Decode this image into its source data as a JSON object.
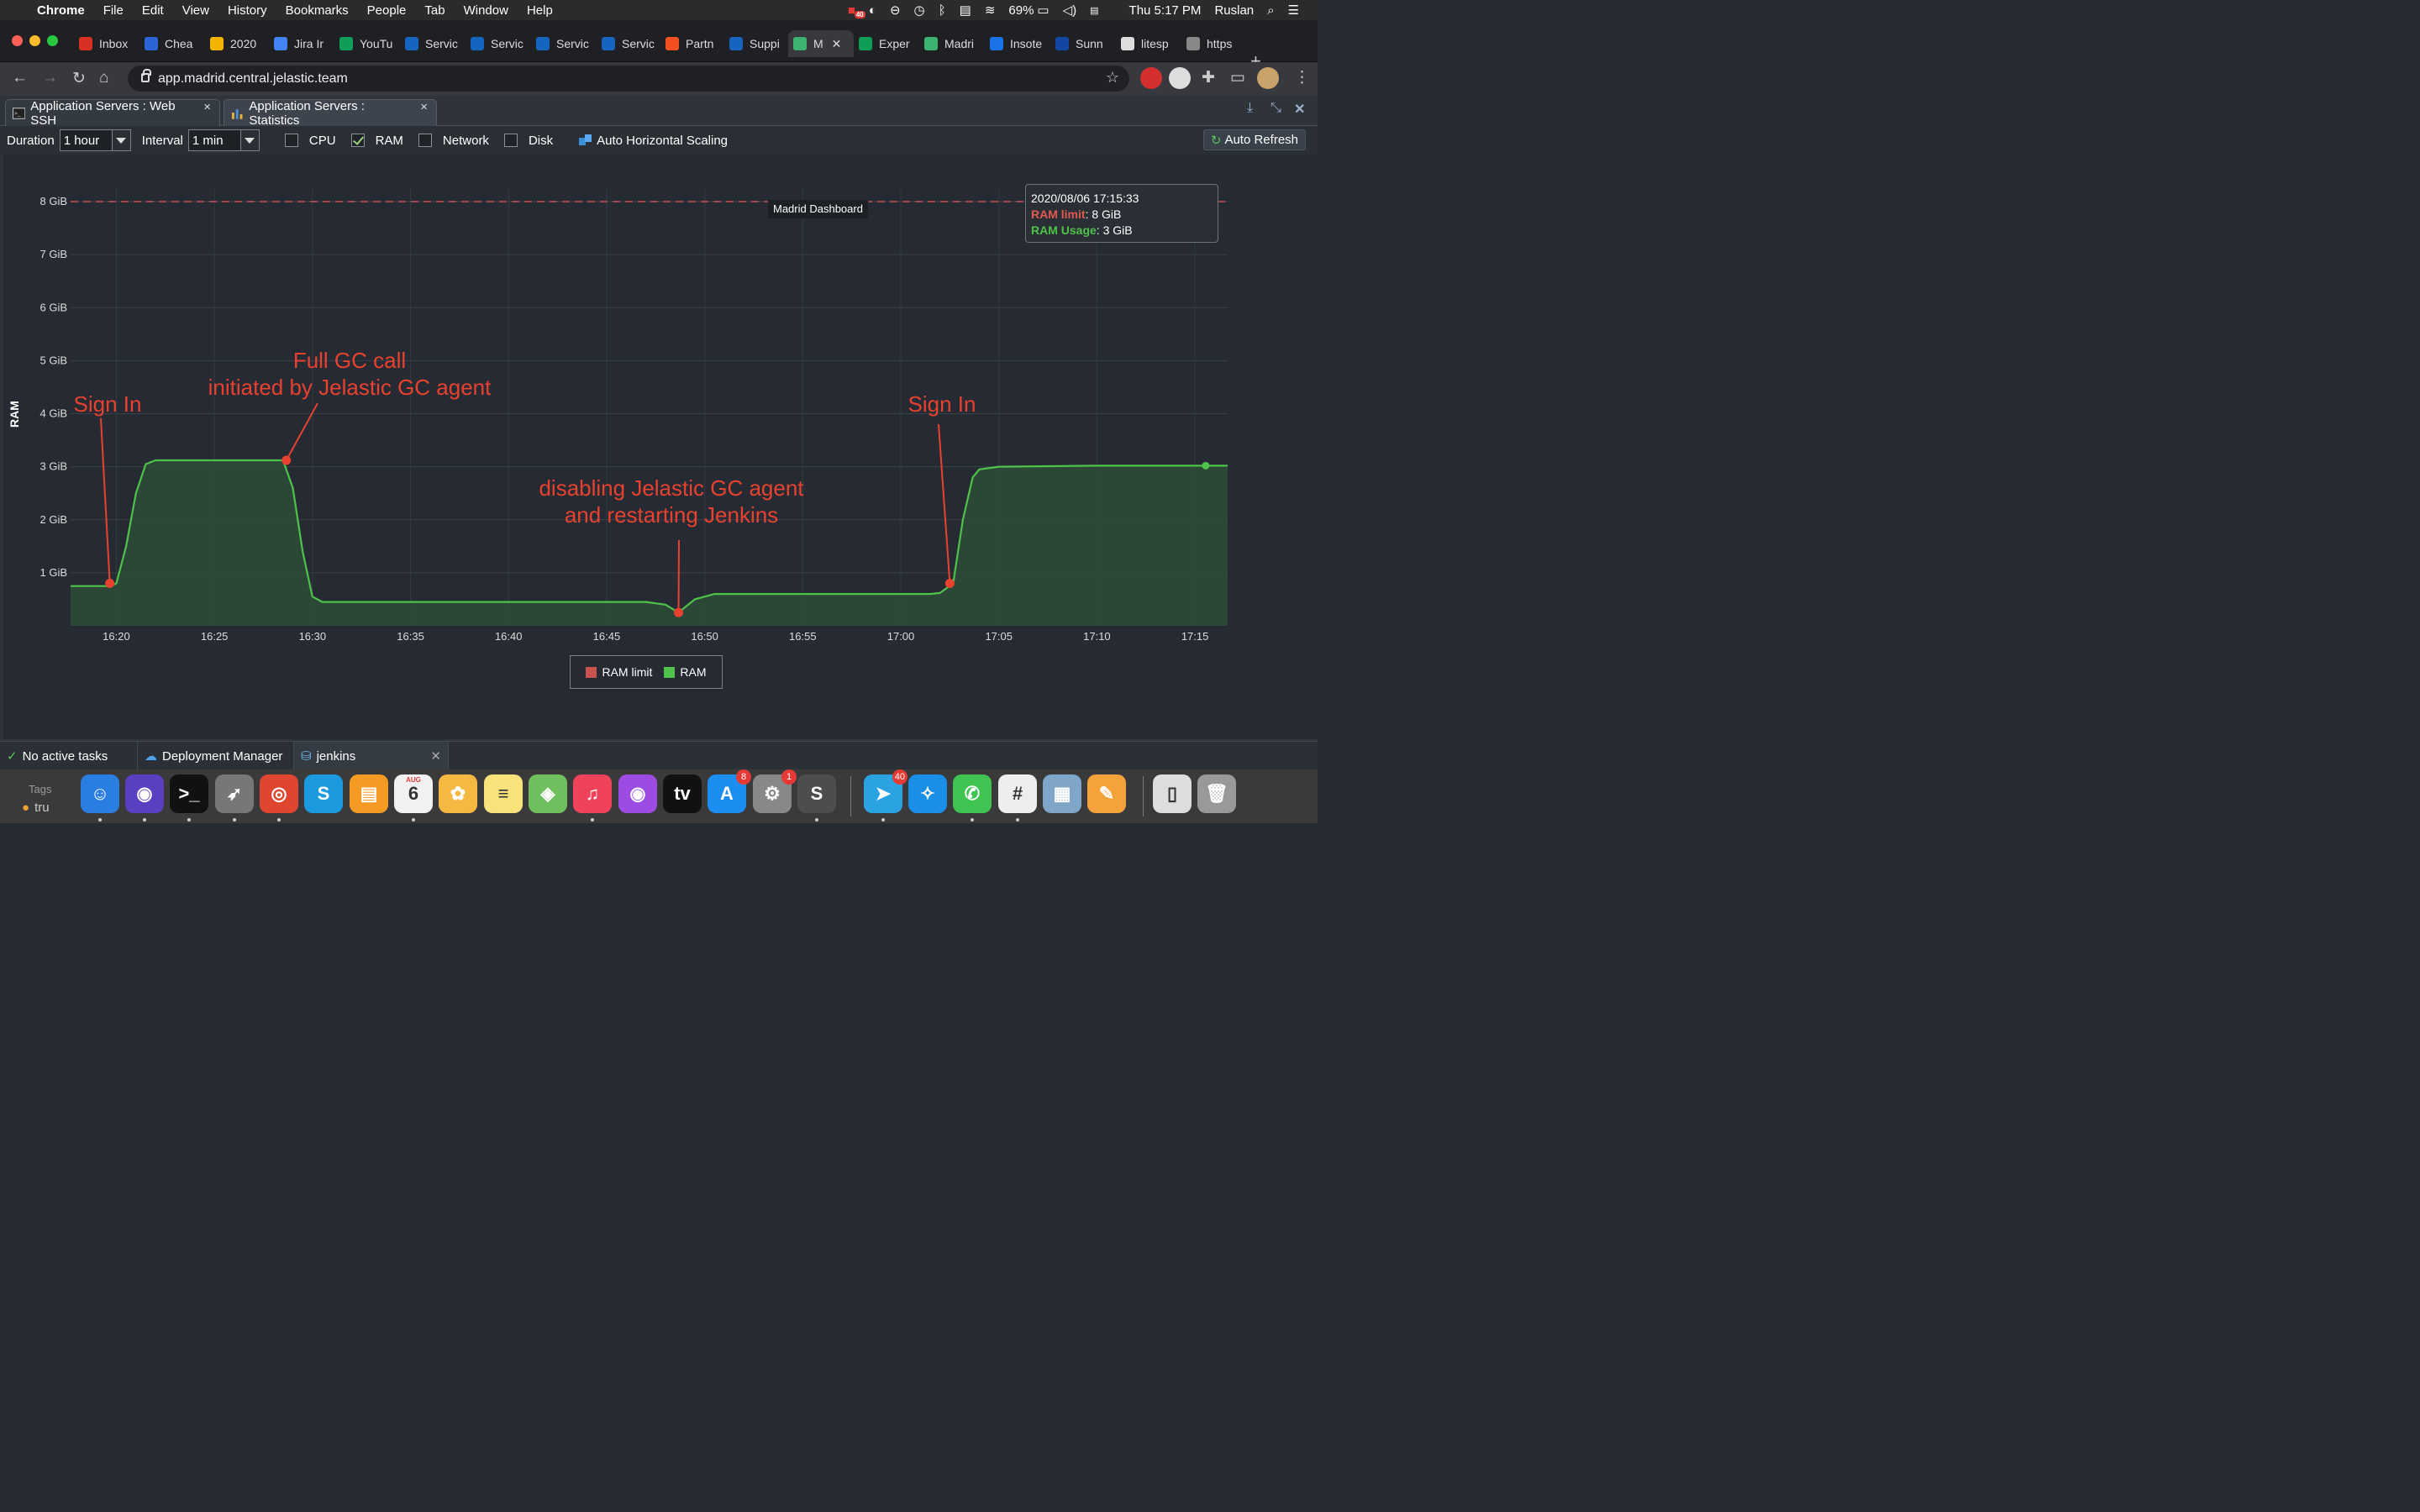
{
  "menubar": {
    "app_name": "Chrome",
    "items": [
      "File",
      "Edit",
      "View",
      "History",
      "Bookmarks",
      "People",
      "Tab",
      "Window",
      "Help"
    ],
    "battery": "69%",
    "clock": "Thu 5:17 PM",
    "user": "Ruslan",
    "badge": "40"
  },
  "browser": {
    "tabs": [
      "Inbox",
      "Chea",
      "2020",
      "Jira Ir",
      "YouTu",
      "Servic",
      "Servic",
      "Servic",
      "Servic",
      "Partn",
      "Suppi",
      "M",
      "Exper",
      "Madri",
      "Insote",
      "Sunn",
      "litesp",
      "https"
    ],
    "url": "app.madrid.central.jelastic.team"
  },
  "app": {
    "tabs": [
      {
        "label": "Application Servers : Web SSH"
      },
      {
        "label": "Application Servers : Statistics"
      }
    ],
    "filters": {
      "duration_label": "Duration",
      "duration_value": "1 hour",
      "interval_label": "Interval",
      "interval_value": "1 min",
      "cpu": "CPU",
      "ram": "RAM",
      "network": "Network",
      "disk": "Disk",
      "ahs": "Auto Horizontal Scaling",
      "refresh": "Auto Refresh"
    },
    "tooltip": {
      "time": "2020/08/06 17:15:33",
      "limit_label": "RAM limit",
      "limit_value": ": 8 GiB",
      "usage_label": "RAM Usage",
      "usage_value": ": 3 GiB"
    },
    "dash_tip": "Madrid Dashboard",
    "status": {
      "tasks": "No active tasks",
      "deployment": "Deployment Manager",
      "env": "jenkins"
    }
  },
  "chart_data": {
    "type": "area",
    "ylabel": "RAM",
    "ylim": [
      0,
      8.5
    ],
    "yticks": [
      "8 GiB",
      "7 GiB",
      "6 GiB",
      "5 GiB",
      "4 GiB",
      "3 GiB",
      "2 GiB",
      "1 GiB"
    ],
    "ytick_values": [
      8,
      7,
      6,
      5,
      4,
      3,
      2,
      1
    ],
    "xticks": [
      "16:20",
      "16:25",
      "16:30",
      "16:35",
      "16:40",
      "16:45",
      "16:50",
      "16:55",
      "17:00",
      "17:05",
      "17:10",
      "17:15"
    ],
    "xtick_values": [
      "16:20",
      "16:25",
      "16:30",
      "16:35",
      "16:40",
      "16:45",
      "16:50",
      "16:55",
      "17:00",
      "17:05",
      "17:10",
      "17:15"
    ],
    "xlim": [
      "16:17:40",
      "16:16:40"
    ],
    "x_range": [
      "16:17:40",
      "17:16:40"
    ],
    "legend": [
      "RAM limit",
      "RAM"
    ],
    "legend_position": "bottom-center",
    "colors": {
      "limit": "#c9534f",
      "ram": "#4ec24a",
      "ram_fill": "#2c4a36"
    },
    "series": [
      {
        "name": "RAM limit",
        "x": [
          "16:17:40",
          "17:16:40"
        ],
        "values": [
          8,
          8
        ]
      },
      {
        "name": "RAM",
        "x": [
          "16:17:40",
          "16:19:40",
          "16:20:00",
          "16:20:30",
          "16:21:00",
          "16:21:30",
          "16:22:00",
          "16:28:30",
          "16:29:00",
          "16:29:30",
          "16:30:00",
          "16:30:30",
          "16:47:00",
          "16:48:00",
          "16:48:40",
          "16:49:30",
          "16:50:30",
          "17:01:30",
          "17:02:00",
          "17:02:40",
          "17:03:10",
          "17:03:40",
          "17:04:00",
          "17:05:00",
          "17:10:00",
          "17:15:33",
          "17:16:40"
        ],
        "values": [
          0.75,
          0.75,
          0.8,
          1.5,
          2.5,
          3.05,
          3.12,
          3.12,
          2.6,
          1.4,
          0.55,
          0.45,
          0.45,
          0.4,
          0.25,
          0.5,
          0.6,
          0.6,
          0.62,
          0.8,
          2.0,
          2.8,
          2.95,
          3.0,
          3.02,
          3.02,
          3.02
        ]
      }
    ],
    "annotations": [
      {
        "text": [
          "Sign In"
        ],
        "x": "16:19:40",
        "y": 0.8
      },
      {
        "text": [
          "Full GC call",
          "initiated by Jelastic GC agent"
        ],
        "x": "16:28:40",
        "y": 3.12
      },
      {
        "text": [
          "disabling Jelastic GC agent",
          "and restarting Jenkins"
        ],
        "x": "16:48:40",
        "y": 0.25
      },
      {
        "text": [
          "Sign In"
        ],
        "x": "17:02:30",
        "y": 0.8
      }
    ]
  },
  "dock": {
    "tags_label": "Tags",
    "tag_item": "tru",
    "items": [
      {
        "name": "finder",
        "glyph": "☺",
        "color": "#2a7de1"
      },
      {
        "name": "siri",
        "glyph": "◉",
        "color": "#5a3fc0"
      },
      {
        "name": "terminal",
        "glyph": ">_",
        "color": "#111"
      },
      {
        "name": "launchpad",
        "glyph": "➶",
        "color": "#777"
      },
      {
        "name": "chrome",
        "glyph": "◎",
        "color": "#e0452f"
      },
      {
        "name": "skype",
        "glyph": "S",
        "color": "#1b9ae0"
      },
      {
        "name": "books",
        "glyph": "▤",
        "color": "#f59a23"
      },
      {
        "name": "calendar",
        "glyph": "6",
        "color": "#f2f2f2",
        "label": "AUG"
      },
      {
        "name": "photos",
        "glyph": "✿",
        "color": "#f5b942"
      },
      {
        "name": "notes",
        "glyph": "≡",
        "color": "#f8e27a"
      },
      {
        "name": "maps",
        "glyph": "◈",
        "color": "#6fbf5f"
      },
      {
        "name": "music",
        "glyph": "♫",
        "color": "#f0435b"
      },
      {
        "name": "podcasts",
        "glyph": "◉",
        "color": "#9c4be3"
      },
      {
        "name": "tv",
        "glyph": "tv",
        "color": "#111"
      },
      {
        "name": "app-store",
        "glyph": "A",
        "color": "#1c8ef2",
        "badge": "8"
      },
      {
        "name": "system-preferences",
        "glyph": "⚙",
        "color": "#888",
        "badge": "1"
      },
      {
        "name": "sublime",
        "glyph": "S",
        "color": "#4d4d4d"
      },
      {
        "name": "telegram",
        "glyph": "➤",
        "color": "#2aa3e0",
        "badge": "40"
      },
      {
        "name": "safari",
        "glyph": "✧",
        "color": "#1b8ee8"
      },
      {
        "name": "whatsapp",
        "glyph": "✆",
        "color": "#3fc451"
      },
      {
        "name": "slack",
        "glyph": "#",
        "color": "#eee"
      },
      {
        "name": "preview",
        "glyph": "▦",
        "color": "#7fa6c9"
      },
      {
        "name": "pages",
        "glyph": "✎",
        "color": "#f4a23a"
      },
      {
        "name": "documents",
        "glyph": "▯",
        "color": "#ddd"
      },
      {
        "name": "trash",
        "glyph": "🗑",
        "color": "#999"
      }
    ]
  }
}
